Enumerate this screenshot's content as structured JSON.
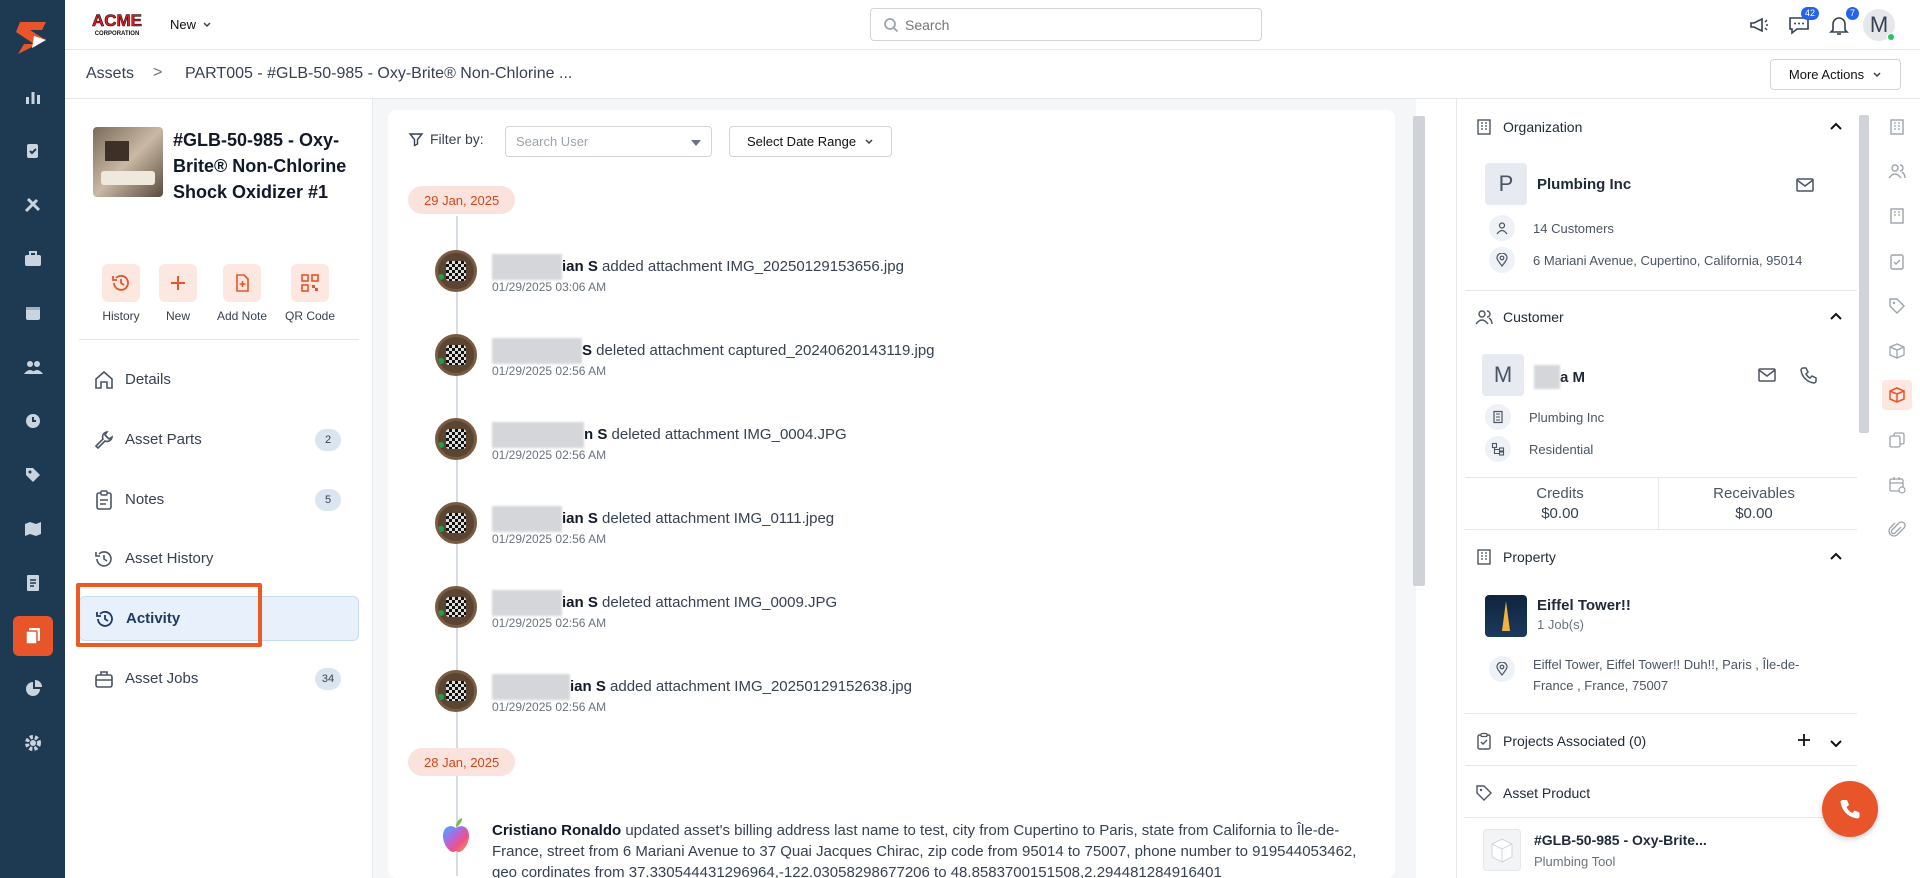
{
  "app": {
    "brand_text": "ACME",
    "brand_sub": "CORPORATION",
    "new_label": "New",
    "search_placeholder": "Search",
    "messages_count": "42",
    "notifications_count": "7",
    "user_initial": "M",
    "accent": "#e8552a",
    "nav_bg": "#1e3a52"
  },
  "breadcrumb": {
    "root": "Assets",
    "separator": ">",
    "current": "PART005 - #GLB-50-985 - Oxy-Brite® Non-Chlorine ...",
    "more_actions": "More Actions"
  },
  "asset": {
    "title": "#GLB-50-985 - Oxy-Brite® Non-Chlorine Shock Oxidizer #1",
    "quick_actions": [
      "History",
      "New",
      "Add Note",
      "QR Code"
    ],
    "menu": [
      {
        "label": "Details",
        "count": ""
      },
      {
        "label": "Asset Parts",
        "count": "2"
      },
      {
        "label": "Notes",
        "count": "5"
      },
      {
        "label": "Asset History",
        "count": ""
      },
      {
        "label": "Activity",
        "count": ""
      },
      {
        "label": "Asset Jobs",
        "count": "34"
      }
    ]
  },
  "feed": {
    "filter_label": "Filter by:",
    "user_placeholder": "Search User",
    "date_range_label": "Select Date Range",
    "date_groups": [
      "29 Jan, 2025",
      "28 Jan, 2025"
    ],
    "entries": [
      {
        "user": "ian S",
        "action": " added attachment IMG_20250129153656.jpg",
        "time": "01/29/2025 03:06 AM"
      },
      {
        "user": "S",
        "action": " deleted attachment captured_20240620143119.jpg",
        "time": "01/29/2025 02:56 AM"
      },
      {
        "user": "n S",
        "action": " deleted attachment IMG_0004.JPG",
        "time": "01/29/2025 02:56 AM"
      },
      {
        "user": "ian S",
        "action": " deleted attachment IMG_0111.jpeg",
        "time": "01/29/2025 02:56 AM"
      },
      {
        "user": "ian S",
        "action": " deleted attachment IMG_0009.JPG",
        "time": "01/29/2025 02:56 AM"
      },
      {
        "user": "ian S",
        "action": " added attachment IMG_20250129152638.jpg",
        "time": "01/29/2025 02:56 AM"
      }
    ],
    "last_entry": {
      "user": "Cristiano Ronaldo",
      "action": " updated asset's billing address last name to test, city from Cupertino to Paris, state from California to Île-de-France, street from 6 Mariani Avenue to 37 Quai Jacques Chirac, zip code from 95014 to 75007, phone number to 919544053462, geo cordinates from 37.330544431296964,-122.03058298677206 to 48.8583700151508,2.294481284916401"
    }
  },
  "details": {
    "organization": {
      "title": "Organization",
      "initial": "P",
      "name": "Plumbing Inc",
      "customers": "14 Customers",
      "address": "6 Mariani Avenue, Cupertino, California, 95014"
    },
    "customer": {
      "title": "Customer",
      "initial": "M",
      "name": "a M",
      "org": "Plumbing Inc",
      "type": "Residential",
      "credits_label": "Credits",
      "credits_value": "$0.00",
      "receivables_label": "Receivables",
      "receivables_value": "$0.00"
    },
    "property": {
      "title": "Property",
      "name": "Eiffel Tower!!",
      "jobs": "1 Job(s)",
      "address": "Eiffel Tower, Eiffel Tower!! Duh!!, Paris , Île-de-France , France, 75007"
    },
    "projects": {
      "title": "Projects Associated (0)"
    },
    "product": {
      "title": "Asset Product",
      "name": "#GLB-50-985 - Oxy-Brite...",
      "category": "Plumbing Tool"
    }
  }
}
